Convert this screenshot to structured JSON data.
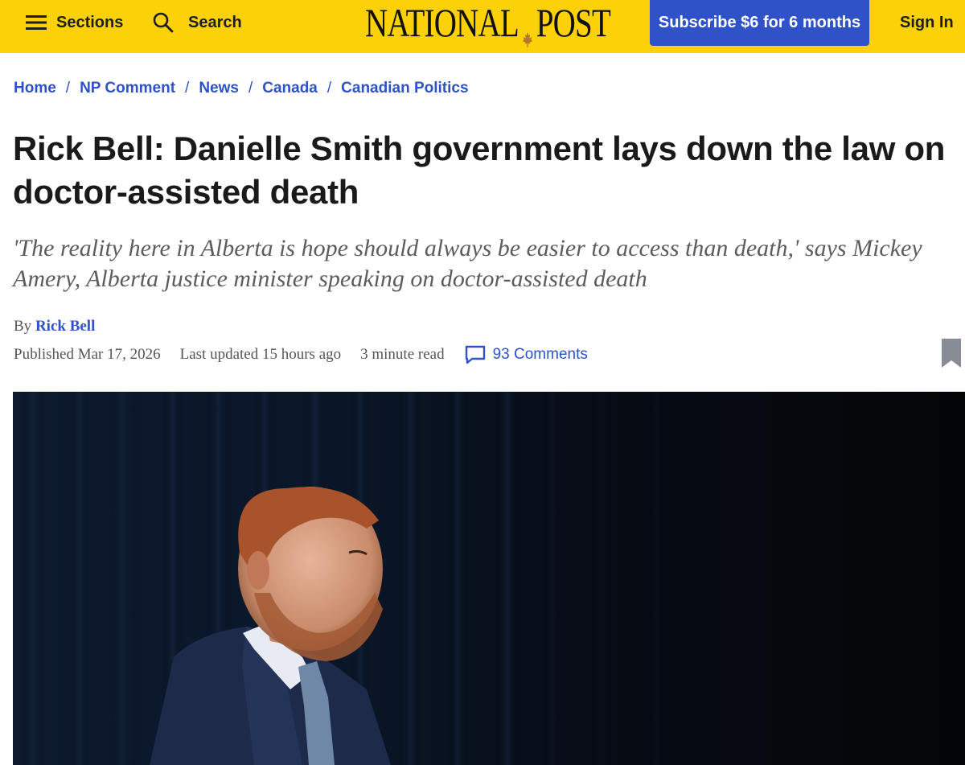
{
  "header": {
    "sections_label": "Sections",
    "search_label": "Search",
    "logo_left": "NATIONAL",
    "logo_right": "POST",
    "subscribe_label": "Subscribe $6 for 6 months",
    "signin_label": "Sign In",
    "accent_color": "#fdd108",
    "button_color": "#2f52c8"
  },
  "breadcrumb": [
    {
      "label": "Home"
    },
    {
      "label": "NP Comment"
    },
    {
      "label": "News"
    },
    {
      "label": "Canada"
    },
    {
      "label": "Canadian Politics"
    }
  ],
  "article": {
    "headline": "Rick Bell: Danielle Smith government lays down the law on doctor-assisted death",
    "dek": "'The reality here in Alberta is hope should always be easier to access than death,' says Mickey Amery, Alberta justice minister speaking on doctor-assisted death",
    "byline_prefix": "By",
    "author": "Rick Bell",
    "published": "Published Mar 17, 2026",
    "updated": "Last updated 15 hours ago",
    "read_time": "3 minute read",
    "comments": "93 Comments"
  },
  "icons": {
    "menu": "hamburger-icon",
    "search": "search-icon",
    "logo_leaf": "maple-leaf-icon",
    "comments": "comment-bubble-icon",
    "bookmark": "bookmark-icon"
  }
}
